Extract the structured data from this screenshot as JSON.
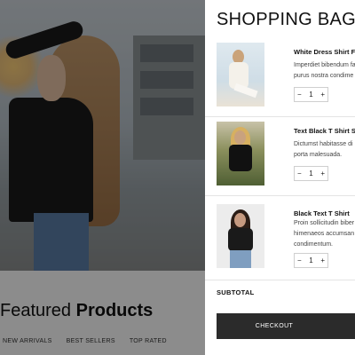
{
  "page": {
    "featured_light": "Featured ",
    "featured_bold": "Products",
    "tabs": [
      "NEW ARRIVALS",
      "BEST SELLERS",
      "TOP RATED"
    ]
  },
  "cart": {
    "title": "SHOPPING BAG",
    "items": [
      {
        "name": "White Dress Shirt Fo",
        "desc": [
          "Imperdiet bibendum fa",
          "purus nostra condime"
        ],
        "qty": "1",
        "minus": "−",
        "plus": "+"
      },
      {
        "name": "Text Black T Shirt Sh",
        "desc": [
          "Dictumst habitasse di",
          "porta malesuada."
        ],
        "qty": "1",
        "minus": "−",
        "plus": "+"
      },
      {
        "name": "Black Text T Shirt",
        "desc": [
          "Proin sollicitudin biber",
          "himenaeos accumsan",
          "condimentum."
        ],
        "qty": "1",
        "minus": "−",
        "plus": "+"
      }
    ],
    "subtotal_label": "SUBTOTAL",
    "checkout_label": "CHECKOUT"
  },
  "colors": {
    "overlay": "#000000",
    "checkout_bg": "#2b2b2b"
  }
}
